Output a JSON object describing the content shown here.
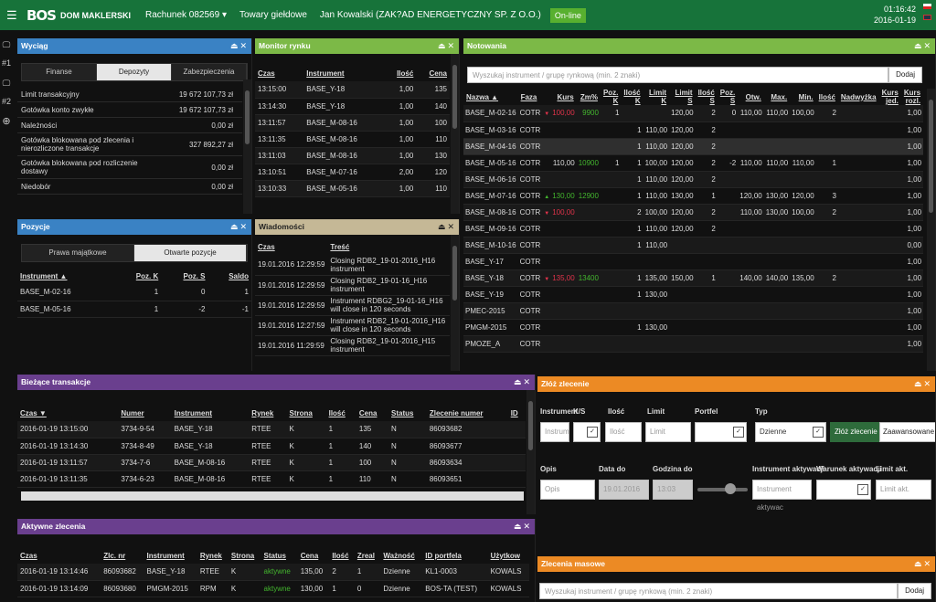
{
  "topbar": {
    "logo": "BOS",
    "logo_sub": "DOM MAKLERSKI",
    "account": "Rachunek 082569 ▾",
    "market": "Towary giełdowe",
    "user": "Jan Kowalski (ZAK?AD ENERGETYCZNY SP. Z O.O.)",
    "status": "On-line",
    "time": "01:16:42",
    "date": "2016-01-19"
  },
  "sidebar": {
    "ws1": "#1",
    "ws2": "#2"
  },
  "wyciag": {
    "title": "Wyciąg",
    "tabs": [
      "Finanse",
      "Depozyty",
      "Zabezpieczenia"
    ],
    "rows": [
      {
        "k": "Limit transakcyjny",
        "v": "19 672 107,73 zł"
      },
      {
        "k": "Gotówka konto zwykłe",
        "v": "19 672 107,73 zł"
      },
      {
        "k": "Należności",
        "v": "0,00 zł"
      },
      {
        "k": "Gotówka blokowana pod zlecenia i nierozliczone transakcje",
        "v": "327 892,27 zł"
      },
      {
        "k": "Gotówka blokowana pod rozliczenie dostawy",
        "v": "0,00 zł"
      },
      {
        "k": "Niedobór",
        "v": "0,00 zł"
      }
    ]
  },
  "pozycje": {
    "title": "Pozycje",
    "tabs": [
      "Prawa majątkowe",
      "Otwarte pozycje"
    ],
    "headers": [
      "Instrument ▲",
      "Poz. K",
      "Poz. S",
      "Saldo"
    ],
    "rows": [
      [
        "BASE_M-02-16",
        "1",
        "0",
        "1"
      ],
      [
        "BASE_M-05-16",
        "1",
        "-2",
        "-1"
      ]
    ]
  },
  "monitor": {
    "title": "Monitor rynku",
    "headers": [
      "Czas",
      "Instrument",
      "Ilość",
      "Cena"
    ],
    "rows": [
      [
        "13:15:00",
        "BASE_Y-18",
        "1,00",
        "135"
      ],
      [
        "13:14:30",
        "BASE_Y-18",
        "1,00",
        "140"
      ],
      [
        "13:11:57",
        "BASE_M-08-16",
        "1,00",
        "100"
      ],
      [
        "13:11:35",
        "BASE_M-08-16",
        "1,00",
        "110"
      ],
      [
        "13:11:03",
        "BASE_M-08-16",
        "1,00",
        "130"
      ],
      [
        "13:10:51",
        "BASE_M-07-16",
        "2,00",
        "120"
      ],
      [
        "13:10:33",
        "BASE_M-05-16",
        "1,00",
        "110"
      ]
    ]
  },
  "wiadomosci": {
    "title": "Wiadomości",
    "headers": [
      "Czas",
      "Treść"
    ],
    "rows": [
      [
        "19.01.2016 12:29:59",
        "Closing RDB2_19-01-2016_H16 instrument"
      ],
      [
        "19.01.2016 12:29:59",
        "Closing RDB2_19-01-16_H16 instrument"
      ],
      [
        "19.01.2016 12:29:59",
        "Instrument RDBG2_19-01-16_H16 will close in 120 seconds"
      ],
      [
        "19.01.2016 12:27:59",
        "Instrument RDB2_19-01-2016_H16 will close in 120 seconds"
      ],
      [
        "19.01.2016 11:29:59",
        "Closing RDB2_19-01-2016_H15 instrument"
      ]
    ]
  },
  "notowania": {
    "title": "Notowania",
    "search_placeholder": "Wyszukaj instrument / grupę rynkową (min. 2 znaki)",
    "add_label": "Dodaj",
    "headers": [
      "Nazwa ▲",
      "Faza",
      "Kurs",
      "Zm%",
      "Poz. K",
      "Ilość K",
      "Limit K",
      "Limit S",
      "Ilość S",
      "Poz. S",
      "Otw.",
      "Max.",
      "Min.",
      "Ilość",
      "Nadwyżka",
      "Kurs jed.",
      "Kurs rozl."
    ],
    "rows": [
      {
        "c": [
          "BASE_M-02-16",
          "COTR",
          "100,00",
          "9900",
          "1",
          "",
          "",
          "120,00",
          "2",
          "0",
          "110,00",
          "110,00",
          "100,00",
          "2",
          "",
          "",
          "1,00"
        ],
        "dir": "down"
      },
      {
        "c": [
          "BASE_M-03-16",
          "COTR",
          "",
          "",
          "",
          "1",
          "110,00",
          "120,00",
          "2",
          "",
          "",
          "",
          "",
          "",
          "",
          "",
          "1,00"
        ],
        "dir": ""
      },
      {
        "c": [
          "BASE_M-04-16",
          "COTR",
          "",
          "",
          "",
          "1",
          "110,00",
          "120,00",
          "2",
          "",
          "",
          "",
          "",
          "",
          "",
          "",
          "1,00"
        ],
        "dir": "",
        "sel": true
      },
      {
        "c": [
          "BASE_M-05-16",
          "COTR",
          "110,00",
          "10900",
          "1",
          "1",
          "100,00",
          "120,00",
          "2",
          "-2",
          "110,00",
          "110,00",
          "110,00",
          "1",
          "",
          "",
          "1,00"
        ],
        "dir": ""
      },
      {
        "c": [
          "BASE_M-06-16",
          "COTR",
          "",
          "",
          "",
          "1",
          "110,00",
          "120,00",
          "2",
          "",
          "",
          "",
          "",
          "",
          "",
          "",
          "1,00"
        ],
        "dir": ""
      },
      {
        "c": [
          "BASE_M-07-16",
          "COTR",
          "130,00",
          "12900",
          "",
          "1",
          "110,00",
          "130,00",
          "1",
          "",
          "120,00",
          "130,00",
          "120,00",
          "3",
          "",
          "",
          "1,00"
        ],
        "dir": "up"
      },
      {
        "c": [
          "BASE_M-08-16",
          "COTR",
          "100,00",
          "",
          "",
          "2",
          "100,00",
          "120,00",
          "2",
          "",
          "110,00",
          "130,00",
          "100,00",
          "2",
          "",
          "",
          "1,00"
        ],
        "dir": "down"
      },
      {
        "c": [
          "BASE_M-09-16",
          "COTR",
          "",
          "",
          "",
          "1",
          "110,00",
          "120,00",
          "2",
          "",
          "",
          "",
          "",
          "",
          "",
          "",
          "1,00"
        ],
        "dir": ""
      },
      {
        "c": [
          "BASE_M-10-16",
          "COTR",
          "",
          "",
          "",
          "1",
          "110,00",
          "",
          "",
          "",
          "",
          "",
          "",
          "",
          "",
          "",
          "0,00"
        ],
        "dir": ""
      },
      {
        "c": [
          "BASE_Y-17",
          "COTR",
          "",
          "",
          "",
          "",
          "",
          "",
          "",
          "",
          "",
          "",
          "",
          "",
          "",
          "",
          "1,00"
        ],
        "dir": ""
      },
      {
        "c": [
          "BASE_Y-18",
          "COTR",
          "135,00",
          "13400",
          "",
          "1",
          "135,00",
          "150,00",
          "1",
          "",
          "140,00",
          "140,00",
          "135,00",
          "2",
          "",
          "",
          "1,00"
        ],
        "dir": "down"
      },
      {
        "c": [
          "BASE_Y-19",
          "COTR",
          "",
          "",
          "",
          "1",
          "130,00",
          "",
          "",
          "",
          "",
          "",
          "",
          "",
          "",
          "",
          "1,00"
        ],
        "dir": ""
      },
      {
        "c": [
          "PMEC-2015",
          "COTR",
          "",
          "",
          "",
          "",
          "",
          "",
          "",
          "",
          "",
          "",
          "",
          "",
          "",
          "",
          "1,00"
        ],
        "dir": ""
      },
      {
        "c": [
          "PMGM-2015",
          "COTR",
          "",
          "",
          "",
          "1",
          "130,00",
          "",
          "",
          "",
          "",
          "",
          "",
          "",
          "",
          "",
          "1,00"
        ],
        "dir": ""
      },
      {
        "c": [
          "PMOZE_A",
          "COTR",
          "",
          "",
          "",
          "",
          "",
          "",
          "",
          "",
          "",
          "",
          "",
          "",
          "",
          "",
          "1,00"
        ],
        "dir": ""
      }
    ]
  },
  "biezace": {
    "title": "Bieżące transakcje",
    "headers": [
      "Czas ▼",
      "Numer",
      "Instrument",
      "Rynek",
      "Strona",
      "Ilość",
      "Cena",
      "Status",
      "Zlecenie numer",
      "ID"
    ],
    "rows": [
      [
        "2016-01-19 13:15:00",
        "3734-9-54",
        "BASE_Y-18",
        "RTEE",
        "K",
        "1",
        "135",
        "N",
        "86093682",
        ""
      ],
      [
        "2016-01-19 13:14:30",
        "3734-8-49",
        "BASE_Y-18",
        "RTEE",
        "K",
        "1",
        "140",
        "N",
        "86093677",
        ""
      ],
      [
        "2016-01-19 13:11:57",
        "3734-7-6",
        "BASE_M-08-16",
        "RTEE",
        "K",
        "1",
        "100",
        "N",
        "86093634",
        ""
      ],
      [
        "2016-01-19 13:11:35",
        "3734-6-23",
        "BASE_M-08-16",
        "RTEE",
        "K",
        "1",
        "110",
        "N",
        "86093651",
        ""
      ]
    ]
  },
  "aktywne": {
    "title": "Aktywne zlecenia",
    "headers": [
      "Czas",
      "Zlc. nr",
      "Instrument",
      "Rynek",
      "Strona",
      "Status",
      "Cena",
      "Ilość",
      "Zreal",
      "Ważność",
      "ID portfela",
      "Użytkow"
    ],
    "rows": [
      [
        "2016-01-19 13:14:46",
        "86093682",
        "BASE_Y-18",
        "RTEE",
        "K",
        "aktywne",
        "135,00",
        "2",
        "1",
        "Dzienne",
        "KL1-0003",
        "KOWALS"
      ],
      [
        "2016-01-19 13:14:09",
        "86093680",
        "PMGM-2015",
        "RPM",
        "K",
        "aktywne",
        "130,00",
        "1",
        "0",
        "Dzienne",
        "BOS-TA (TEST)",
        "KOWALS"
      ]
    ]
  },
  "zloz": {
    "title": "Złóż zlecenie",
    "labels": {
      "instrument": "Instrument",
      "ks": "K/S",
      "ilosc": "Ilość",
      "limit": "Limit",
      "portfel": "Portfel",
      "typ": "Typ",
      "opis": "Opis",
      "data_do": "Data do",
      "godzina_do": "Godzina do",
      "instr_akt": "Instrument aktywacji",
      "warunek": "Warunek aktywacji",
      "limit_akt": "Limit akt."
    },
    "placeholders": {
      "instrument": "Instrum",
      "ilosc": "Ilość",
      "limit": "Limit",
      "opis": "Opis",
      "instr_akt": "Instrument aktywac",
      "limit_akt": "Limit akt."
    },
    "values": {
      "typ": "Dzienne",
      "data_do": "19.01.2016",
      "godzina_do": "13:03"
    },
    "buttons": {
      "submit": "Złóż zlecenie",
      "advanced": "Zaawansowane"
    }
  },
  "masowe": {
    "title": "Zlecenia masowe",
    "search_placeholder": "Wyszukaj instrument / grupę rynkową (min. 2 znaki)",
    "add_label": "Dodaj"
  }
}
